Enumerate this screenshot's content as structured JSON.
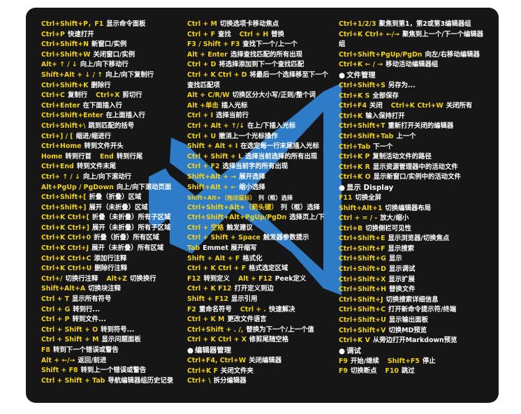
{
  "colors": {
    "key": "#f2d21b",
    "text": "#ffffff",
    "background": "#161616",
    "logo": "#2e7bc7"
  },
  "logo": {
    "name": "vscode-logo-icon"
  },
  "col1": [
    {
      "k": "Ctrl+Shift+P，F1",
      "d": "显示命令面板"
    },
    {
      "k": "Ctrl+P",
      "d": "快速打开"
    },
    {
      "k": "Ctrl+Shift+N",
      "d": "新窗口/实例"
    },
    {
      "k": "Ctrl+Shift+W",
      "d": "关闭窗口/实例"
    },
    {
      "k": "Alt+ ↑ / ↓",
      "d": "向上/向下移动行"
    },
    {
      "k": "Shift+Alt + ↓ / ↑",
      "d": "向上/向下复制行"
    },
    {
      "k": "Ctrl+Shift+K",
      "d": "删除行"
    },
    {
      "k": "Ctrl+C",
      "d": "复制行",
      "k2": "Ctrl+X",
      "d2": "剪切行"
    },
    {
      "k": "Ctrl+Enter",
      "d": "在下面插入行"
    },
    {
      "k": "Ctrl+Shift+Enter",
      "d": "在上面插入行"
    },
    {
      "k": "Ctrl+Shift+\\",
      "d": "跳到匹配的括号"
    },
    {
      "k": "Ctrl+] / [",
      "d": "缩进/缩进行"
    },
    {
      "k": "Ctrl+Home",
      "d": "转到文件开头"
    },
    {
      "k": "Home",
      "d": "转到行首",
      "k2": "End",
      "d2": "转到行尾"
    },
    {
      "k": "Ctrl+End",
      "d": "转到文件末尾"
    },
    {
      "k": "Ctrl+ ↑ / ↓",
      "d": "向上/向下滚动行"
    },
    {
      "k": "Alt+PgUp / PgDown",
      "d": "向上/向下滚动页面"
    },
    {
      "k": "Ctrl+Shift+[",
      "d": "折叠（折叠）区域"
    },
    {
      "k": "Ctrl+Shift+]",
      "d": "展开（未折叠）区域"
    },
    {
      "k": "Ctrl+K Ctrl+[",
      "d": "折叠（未折叠）所有子区域"
    },
    {
      "k": "Ctrl+K Ctrl+]",
      "d": "展开（未折叠）所有子区域"
    },
    {
      "k": "Ctrl+K Ctrl+0",
      "d": "折叠（折叠）所有区域"
    },
    {
      "k": "Ctrl+K Ctrl+J",
      "d": "展开（未折叠）所有区域"
    },
    {
      "k": "Ctrl+K Ctrl+C",
      "d": "添加行注释"
    },
    {
      "k": "Ctrl+K Ctrl+U",
      "d": "删除行注释"
    },
    {
      "k": "Ctrl+/",
      "d": "切换行注释",
      "k2": "Alt+Z",
      "d2": "切换换行"
    },
    {
      "k": "Shift+Alt+A",
      "d": "切换块注释"
    },
    {
      "k": "Ctrl + T",
      "d": "显示所有符号"
    },
    {
      "k": "Ctrl + G",
      "d": "转到行..."
    },
    {
      "k": "Ctrl + P",
      "d": "转到文件..."
    },
    {
      "k": "Ctrl + Shift + O",
      "d": "转到符号..."
    },
    {
      "k": "Ctrl + Shift + M",
      "d": "显示问题面板"
    },
    {
      "k": "F8",
      "d": "转到下一个错误或警告"
    },
    {
      "k": "Alt + ←/→",
      "d": "返回/前进"
    },
    {
      "k": "Shift + F8",
      "d": "转到上一个错误或警告"
    },
    {
      "k": "Ctrl + Shift + Tab",
      "d": "导航编辑器组历史记录"
    }
  ],
  "col2": [
    {
      "k": "Ctrl + M",
      "d": "切换选项卡移动焦点"
    },
    {
      "k": "Ctrl + F",
      "d": "查找",
      "k2": "Ctrl + H",
      "d2": "替换"
    },
    {
      "k": "F3 / Shift + F3",
      "d": "查找下一个/上一个"
    },
    {
      "k": "Alt + Enter",
      "d": "选择查找匹配的所有出现"
    },
    {
      "k": "Ctrl + D",
      "d": "将选择添加到下一个查找匹配"
    },
    {
      "k": "Ctrl + K Ctrl + D",
      "d": "将最后一个选择移至下一个查找匹配项",
      "wrap": true
    },
    {
      "k": "Alt + C/R/W",
      "d": "切换区分大小写/正则/整个词"
    },
    {
      "k": "Alt +单击",
      "d": "插入光标"
    },
    {
      "k": "Ctrl + I",
      "d": "选择当前行"
    },
    {
      "k": "Ctrl + Alt + ↑/↓",
      "d": "在上/下插入光标"
    },
    {
      "k": "Ctrl + U",
      "d": "撤消上一个光标操作"
    },
    {
      "k": "Shift + Alt + I",
      "d": "在选定每一行末尾插入光标"
    },
    {
      "k": "Ctrl + Shift + L",
      "d": "选择当前选择的所有出现"
    },
    {
      "k": "Ctrl + F2",
      "d": "选择当前字的所有出现"
    },
    {
      "k": "Shift+Alt + →",
      "d": "展开选择"
    },
    {
      "k": "Shift+Alt + ←",
      "d": "缩小选择"
    },
    {
      "k": "Shift+Alt+（拖动鼠标）",
      "d": "列（框）选择",
      "small": true
    },
    {
      "k": "Ctrl+Shift+Alt+（箭头键）",
      "d": "列（框）选择"
    },
    {
      "k": "Ctrl+Shift+Alt+PgUp/PgDn",
      "d": "选择页上/下"
    },
    {
      "k": "Ctrl + 空格",
      "d": "触发建议"
    },
    {
      "k": "Ctrl + Shift + Space",
      "d": "触发器参数提示"
    },
    {
      "k": "Tab",
      "d": "Emmet 展开缩写"
    },
    {
      "k": "Shift + Alt + F",
      "d": "格式化"
    },
    {
      "k": "Ctrl + K Ctrl + F",
      "d": "格式选定区域"
    },
    {
      "k": "F12",
      "d": "转到定义",
      "k2": "Alt + F12",
      "d2": "Peek定义"
    },
    {
      "k": "Ctrl + K F12",
      "d": "打开定义到边"
    },
    {
      "k": "Shift + F12",
      "d": "显示引用"
    },
    {
      "k": "F2",
      "d": "重命名符号",
      "k2": "Ctrl + .",
      "d2": "快速解决"
    },
    {
      "k": "Ctrl + K M",
      "d": "更改文件语言"
    },
    {
      "k": "Ctrl+Shift + . /,",
      "d": "替换为下一个/上一个值"
    },
    {
      "k": "Ctrl + K Ctrl + X",
      "d": "修剪尾随空格"
    }
  ],
  "col2_section": "编辑器管理",
  "col2_tail": [
    {
      "k": "Ctrl+F4, Ctrl+W",
      "d": "关闭编辑器"
    },
    {
      "k": "Ctrl+K F",
      "d": "关闭文件夹"
    },
    {
      "k": "Ctrl+ \\",
      "d": "拆分编辑器"
    }
  ],
  "col3_head": [
    {
      "k": "Ctrl+1/2/3",
      "d": "聚焦到第1，第2或第3编辑器组"
    },
    {
      "k": "Ctrl+K Ctrl+ ←/→",
      "d": "聚焦到上一个/下一个编辑器组",
      "wrap": true
    },
    {
      "k": "Ctrl+Shift+PgUp/PgDn",
      "d": "向左/右移动编辑器"
    },
    {
      "k": "Ctrl+K ← / →",
      "d": "移动活动编辑器组"
    }
  ],
  "section_file": "文件管理",
  "col3_file": [
    {
      "k": "Ctrl+Shift+S",
      "d": "另存为..."
    },
    {
      "k": "Ctrl+K S",
      "d": "全部保存"
    },
    {
      "k": "Ctrl+F4",
      "d": "关闭",
      "k2": "Ctrl+K Ctrl+W",
      "d2": "关闭所有"
    },
    {
      "k": "Ctrl+K",
      "d": "输入保持打开"
    },
    {
      "k": "Ctrl+Shift+T",
      "d": "重新打开关闭的编辑器"
    },
    {
      "k": "Ctrl+Shift+Tab",
      "d": "上一个"
    },
    {
      "k": "Ctrl+Tab",
      "d": "下一个"
    },
    {
      "k": "Ctrl+K P",
      "d": "复制活动文件的路径"
    },
    {
      "k": "Ctrl+K R",
      "d": "显示资源管理器中的活动文件"
    },
    {
      "k": "Ctrl+K O",
      "d": "显示新窗口/实例中的活动文件"
    }
  ],
  "section_display": "显示 Display",
  "col3_display": [
    {
      "k": "F11",
      "d": "切换全屏"
    },
    {
      "k": "Shift+Alt+1",
      "d": "切换编辑器布局"
    },
    {
      "k": "Ctrl + = / -",
      "d": "放大/缩小"
    },
    {
      "k": "Ctrl+B",
      "d": "切换侧栏可见性"
    },
    {
      "k": "Ctrl+Shift+E",
      "d": "显示浏览器/切换焦点"
    },
    {
      "k": "Ctrl+Shift+F",
      "d": "显示搜索"
    },
    {
      "k": "Ctrl+Shift+G",
      "d": "显示"
    },
    {
      "k": "Ctrl+Shift+D",
      "d": "显示调试"
    },
    {
      "k": "Ctrl+Shift+X",
      "d": "显示扩展"
    },
    {
      "k": "Ctrl+Shift+H",
      "d": "替换文件"
    },
    {
      "k": "Ctrl+Shift+J",
      "d": "切换搜索详细信息"
    },
    {
      "k": "Ctrl+Shift+C",
      "d": "打开新命令提示符/终端"
    },
    {
      "k": "Ctrl+Shift+U",
      "d": "显示输出面板"
    },
    {
      "k": "Ctrl+Shift+V",
      "d": "切换MD预览"
    },
    {
      "k": "Ctrl+K V",
      "d": "从旁边打开Markdown预览"
    }
  ],
  "section_debug": "调试",
  "col3_debug": [
    {
      "k": "F9",
      "d": "开始/继续",
      "k2": "Shift+F5",
      "d2": "停止"
    },
    {
      "k": "F9",
      "d": "切换断点",
      "k2": "F10",
      "d2": "跳过"
    }
  ]
}
